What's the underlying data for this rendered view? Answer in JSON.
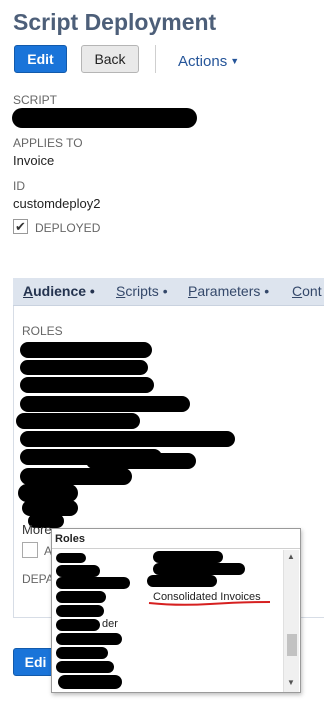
{
  "header": {
    "title": "Script Deployment",
    "edit_label": "Edit",
    "back_label": "Back",
    "actions_label": "Actions",
    "actions_caret": "▼"
  },
  "fields": {
    "script_label": "SCRIPT",
    "applies_to_label": "APPLIES TO",
    "applies_to_value": "Invoice",
    "id_label": "ID",
    "id_value": "customdeploy2",
    "deployed_label": "DEPLOYED",
    "deployed_checked": "✔"
  },
  "tabs": [
    {
      "first": "A",
      "rest": "udience",
      "dot": "•"
    },
    {
      "first": "S",
      "rest": "cripts",
      "dot": "•"
    },
    {
      "first": "P",
      "rest": "arameters",
      "dot": "•"
    },
    {
      "first": "C",
      "rest": "ont",
      "dot": ""
    }
  ],
  "audience": {
    "roles_label": "ROLES",
    "more_label": "More",
    "all_label": "A",
    "dep_label": "DEPA"
  },
  "footer": {
    "edit_label": "Edi"
  },
  "popup": {
    "header": "Roles",
    "visible_items": [
      "Consolidated Invoices",
      "der"
    ],
    "scroll_up": "▲",
    "scroll_down": "▼"
  },
  "colors": {
    "primary": "#1a74d9",
    "title": "#4d5f79",
    "link": "#255599",
    "tab_bar": "#dde4ee",
    "annotation_underline": "#d62020"
  }
}
